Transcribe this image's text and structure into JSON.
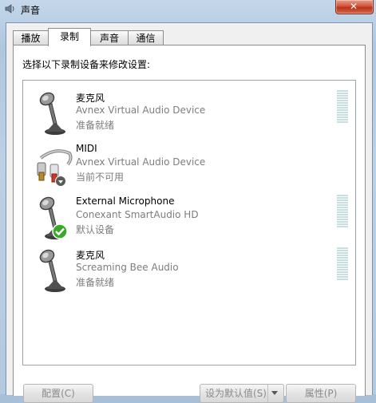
{
  "window": {
    "title": "声音"
  },
  "tabs": [
    {
      "label": "播放",
      "active": false
    },
    {
      "label": "录制",
      "active": true
    },
    {
      "label": "声音",
      "active": false
    },
    {
      "label": "通信",
      "active": false
    }
  ],
  "panel": {
    "instruction": "选择以下录制设备来修改设置:"
  },
  "devices": [
    {
      "name": "麦克风",
      "description": "Avnex Virtual Audio Device",
      "status": "准备就绪",
      "icon": "microphone-icon",
      "badge": null,
      "level": 0
    },
    {
      "name": "MIDI",
      "description": "Avnex Virtual Audio Device",
      "status": "当前不可用",
      "icon": "midi-cable-icon",
      "badge": "down-arrow-badge-icon",
      "level": null
    },
    {
      "name": "External Microphone",
      "description": "Conexant SmartAudio HD",
      "status": "默认设备",
      "icon": "microphone-icon",
      "badge": "default-check-badge-icon",
      "level": 0
    },
    {
      "name": "麦克风",
      "description": "Screaming Bee Audio",
      "status": "准备就绪",
      "icon": "microphone-icon",
      "badge": null,
      "level": 0
    }
  ],
  "buttons": {
    "configure": "配置(C)",
    "set_default": "设为默认值(S)",
    "properties": "属性(P)"
  },
  "colors": {
    "meter": "#c6dfe1",
    "default_badge": "#3aa82a",
    "close_button": "#d3543b"
  }
}
